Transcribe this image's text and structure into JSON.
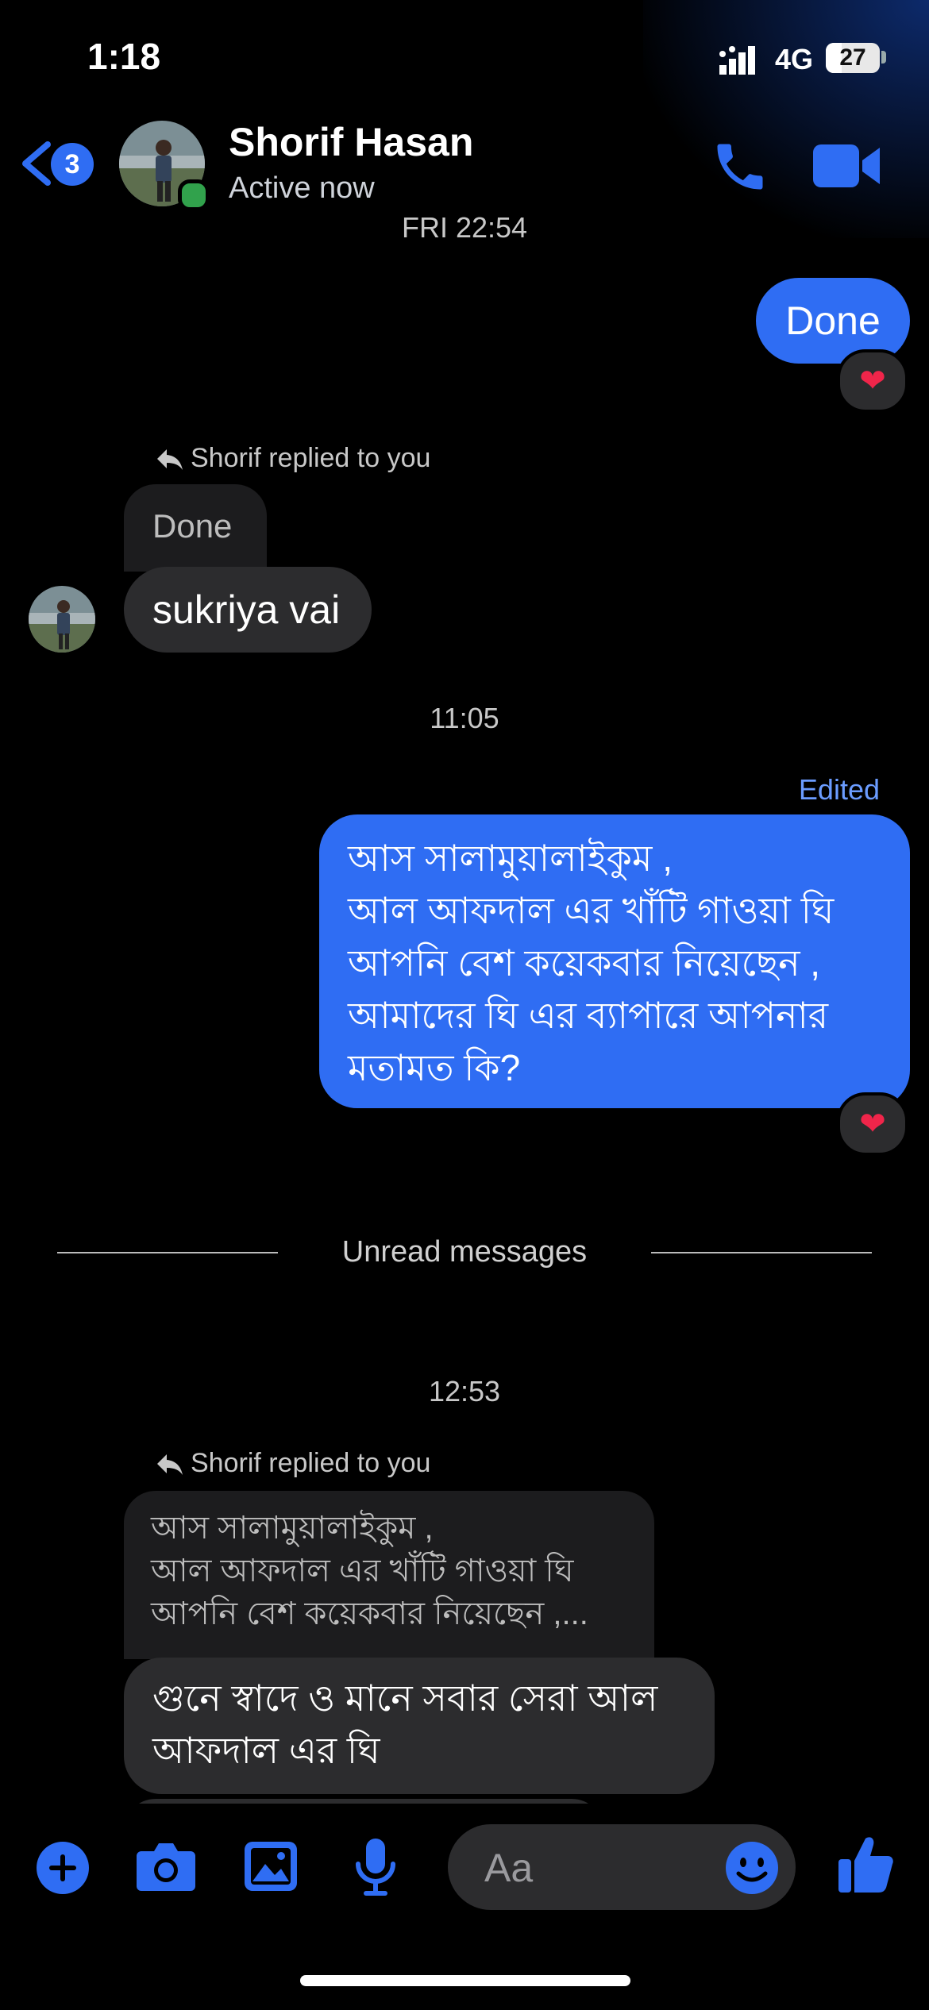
{
  "status_bar": {
    "time": "1:18",
    "network": "4G",
    "battery": "27"
  },
  "header": {
    "back_badge": "3",
    "contact_name": "Shorif Hasan",
    "contact_status": "Active now"
  },
  "conversation": {
    "timestamp_1": "FRI 22:54",
    "msg_done": "Done",
    "reply_note_1": "Shorif replied to you",
    "quoted_1": "Done",
    "msg_sukriya": "sukriya vai",
    "timestamp_2": "11:05",
    "edited_label": "Edited",
    "msg_bengali_lines": [
      "আস সালামুয়ালাইকুম ,",
      "আল আফদাল এর খাঁটি গাওয়া ঘি",
      "আপনি বেশ কয়েকবার নিয়েছেন ,",
      "আমাদের ঘি এর ব্যাপারে আপনার",
      "মতামত কি?"
    ],
    "reaction": "❤",
    "unread_label": "Unread messages",
    "timestamp_3": "12:53",
    "reply_note_2": "Shorif replied to you",
    "quoted_2_lines": [
      "আস সালামুয়ালাইকুম ,",
      "আল আফদাল এর খাঁটি গাওয়া ঘি",
      "আপনি বেশ কয়েকবার নিয়েছেন ,..."
    ],
    "msg_last_lines": [
      "গুনে স্বাদে ও মানে সবার সেরা আল",
      "আফদাল এর ঘি"
    ]
  },
  "composer": {
    "placeholder": "Aa"
  },
  "colors": {
    "accent": "#2f6df3",
    "bubble_received": "#2c2c2e",
    "online": "#31a24c",
    "heart": "#f0254a"
  },
  "icons": [
    "plus-icon",
    "camera-icon",
    "gallery-icon",
    "microphone-icon",
    "emoji-icon",
    "thumbs-up-icon",
    "phone-icon",
    "video-camera-icon",
    "back-chevron-icon",
    "reply-arrow-icon"
  ]
}
